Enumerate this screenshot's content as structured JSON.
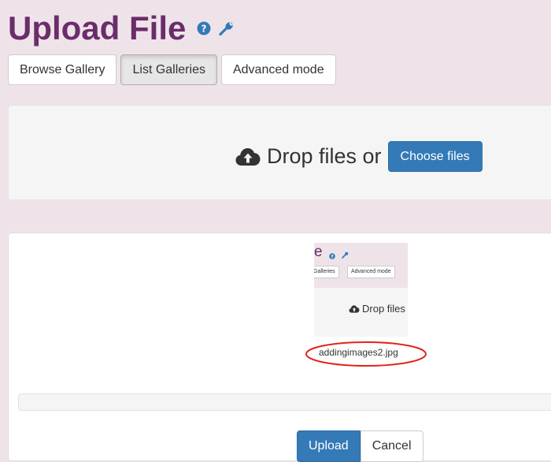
{
  "header": {
    "title": "Upload File",
    "icons": [
      "help-icon",
      "wrench-icon"
    ]
  },
  "toolbar": {
    "browse_gallery": "Browse Gallery",
    "list_galleries": "List Galleries",
    "advanced_mode": "Advanced mode"
  },
  "dropzone": {
    "icon": "cloud-upload-icon",
    "text": "Drop files or",
    "choose_files": "Choose files"
  },
  "preview": {
    "thumbnail": {
      "title_fragment": "e",
      "btn_galleries": "Galleries",
      "btn_advanced": "Advanced mode",
      "drop_text": "Drop files"
    },
    "filename": "addingimages2.jpg"
  },
  "actions": {
    "upload": "Upload",
    "cancel": "Cancel"
  },
  "colors": {
    "page_bg": "#efe3ea",
    "title": "#6b2d6a",
    "primary": "#337ab7",
    "highlight": "#e2231a"
  }
}
